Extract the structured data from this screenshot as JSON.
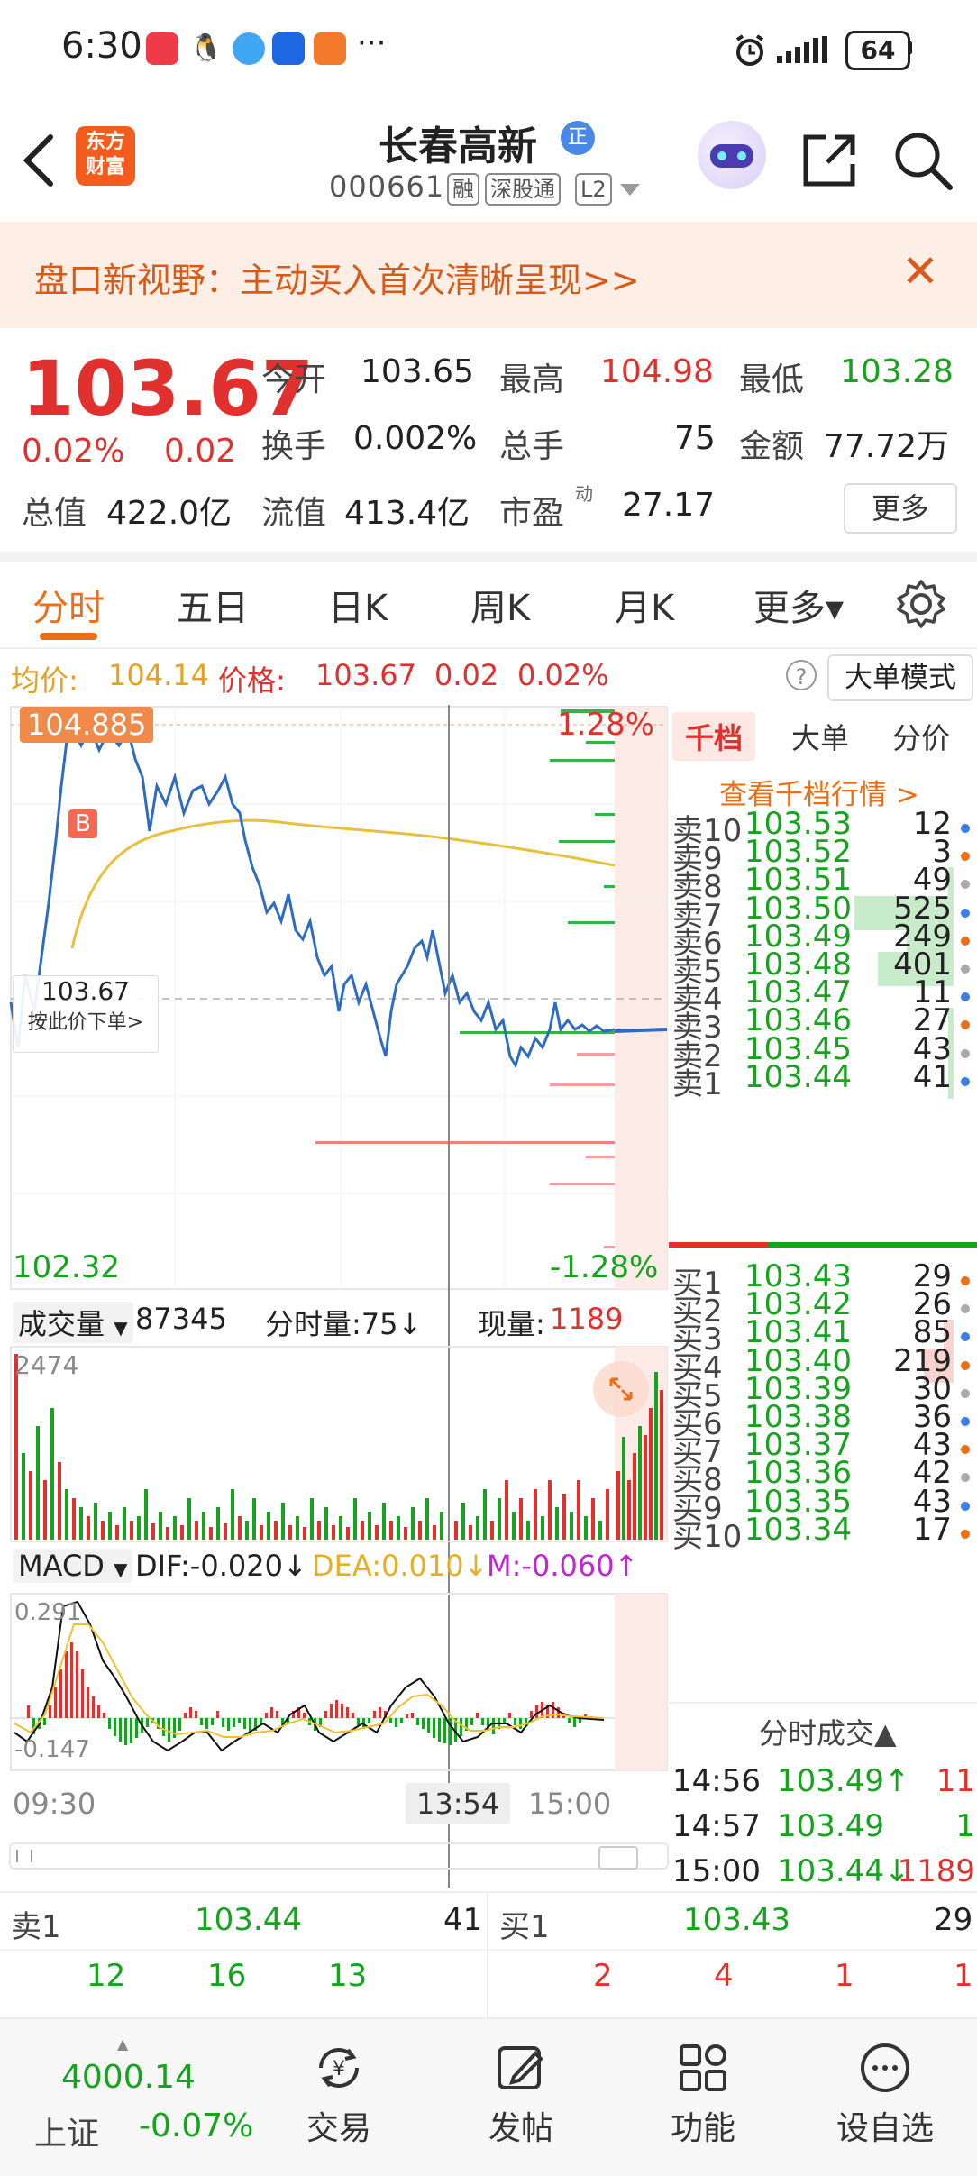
{
  "status_bar": {
    "time": "6:30",
    "more": "···",
    "battery": "64"
  },
  "header": {
    "logo_line1": "东方",
    "logo_line2": "财富",
    "title": "长春高新",
    "title_badge": "正",
    "stock_code": "000661",
    "tags": [
      "融",
      "深股通",
      "L2"
    ]
  },
  "promo": {
    "text": "盘口新视野：主动买入首次清晰呈现>>",
    "close": "✕"
  },
  "quote": {
    "price": "103.67",
    "change_pct": "0.02%",
    "change": "0.02",
    "row1": [
      {
        "label": "今开",
        "value": "103.65",
        "color": "#222222"
      },
      {
        "label": "最高",
        "value": "104.98",
        "color": "#e0312e"
      },
      {
        "label": "最低",
        "value": "103.28",
        "color": "#17a21f"
      }
    ],
    "row2": [
      {
        "label": "换手",
        "value": "0.002%"
      },
      {
        "label": "总手",
        "value": "75"
      },
      {
        "label": "金额",
        "value": "77.72万"
      }
    ],
    "row3": [
      {
        "label": "总值",
        "value": "422.0亿"
      },
      {
        "label": "流值",
        "value": "413.4亿"
      },
      {
        "label": "市盈",
        "sup": "动",
        "value": "27.17"
      }
    ],
    "more_button": "更多"
  },
  "tabs": [
    "分时",
    "五日",
    "日K",
    "周K",
    "月K",
    "更多▾"
  ],
  "info_line": {
    "avg_label": "均价:",
    "avg_value": "104.14",
    "price_label": "价格:",
    "price_value": "103.67",
    "change": "0.02",
    "change_pct": "0.02%",
    "mode_button": "大单模式"
  },
  "chart": {
    "high_label": "104.885",
    "high_pct": "1.28%",
    "low_label": "102.32",
    "low_pct": "-1.28%",
    "b_marker": "B",
    "current_price": "103.67",
    "order_hint": "按此价下单>",
    "volume_header": {
      "label": "成交量",
      "total": "87345",
      "tick_label": "分时量:75↓",
      "now_label": "现量:",
      "now_value": "1189"
    },
    "volume_max": "2474",
    "macd_header": {
      "label": "MACD",
      "dif": "DIF:-0.020↓",
      "dea": "DEA:0.010↓",
      "m": "M:-0.060↑"
    },
    "macd_max": "0.291",
    "macd_min": "-0.147",
    "time_axis": [
      "09:30",
      "13:54",
      "15:00"
    ]
  },
  "order_book": {
    "tabs": [
      "千档",
      "大单",
      "分价"
    ],
    "link": "查看千档行情 >",
    "asks": [
      {
        "label": "卖10",
        "price": "103.53",
        "qty": "12",
        "bar": 0
      },
      {
        "label": "卖9",
        "price": "103.52",
        "qty": "3",
        "bar": 0
      },
      {
        "label": "卖8",
        "price": "103.51",
        "qty": "49",
        "bar": 0.02
      },
      {
        "label": "卖7",
        "price": "103.50",
        "qty": "525",
        "bar": 1
      },
      {
        "label": "卖6",
        "price": "103.49",
        "qty": "249",
        "bar": 0.47
      },
      {
        "label": "卖5",
        "price": "103.48",
        "qty": "401",
        "bar": 0.76
      },
      {
        "label": "卖4",
        "price": "103.47",
        "qty": "11",
        "bar": 0
      },
      {
        "label": "卖3",
        "price": "103.46",
        "qty": "27",
        "bar": 0.02
      },
      {
        "label": "卖2",
        "price": "103.45",
        "qty": "43",
        "bar": 0.02
      },
      {
        "label": "卖1",
        "price": "103.44",
        "qty": "41",
        "bar": 0.02
      }
    ],
    "bids": [
      {
        "label": "买1",
        "price": "103.43",
        "qty": "29",
        "bar": 0
      },
      {
        "label": "买2",
        "price": "103.42",
        "qty": "26",
        "bar": 0
      },
      {
        "label": "买3",
        "price": "103.41",
        "qty": "85",
        "bar": 0.1
      },
      {
        "label": "买4",
        "price": "103.40",
        "qty": "219",
        "bar": 0.3
      },
      {
        "label": "买5",
        "price": "103.39",
        "qty": "30",
        "bar": 0
      },
      {
        "label": "买6",
        "price": "103.38",
        "qty": "36",
        "bar": 0
      },
      {
        "label": "买7",
        "price": "103.37",
        "qty": "43",
        "bar": 0
      },
      {
        "label": "买8",
        "price": "103.36",
        "qty": "42",
        "bar": 0
      },
      {
        "label": "买9",
        "price": "103.35",
        "qty": "43",
        "bar": 0
      },
      {
        "label": "买10",
        "price": "103.34",
        "qty": "17",
        "bar": 0
      }
    ],
    "trades_header": "分时成交▲",
    "trades": [
      {
        "time": "14:56",
        "price": "103.49↑",
        "qty": "11",
        "pcolor": "#17a21f",
        "qcolor": "#e0312e"
      },
      {
        "time": "14:57",
        "price": "103.49",
        "qty": "1",
        "pcolor": "#17a21f",
        "qcolor": "#17a21f"
      },
      {
        "time": "15:00",
        "price": "103.44↓",
        "qty": "1189",
        "pcolor": "#17a21f",
        "qcolor": "#e0312e"
      }
    ]
  },
  "bid_ask": {
    "sell_label": "卖1",
    "sell_price": "103.44",
    "sell_qty": "41",
    "buy_label": "买1",
    "buy_price": "103.43",
    "buy_qty": "29",
    "sell_sizes": [
      "12",
      "16",
      "13"
    ],
    "buy_sizes": [
      "2",
      "4",
      "1",
      "1"
    ]
  },
  "nav": {
    "index_value": "4000.14",
    "index_name": "上证",
    "index_change": "-0.07%",
    "items": [
      "交易",
      "发帖",
      "功能",
      "设自选"
    ]
  }
}
